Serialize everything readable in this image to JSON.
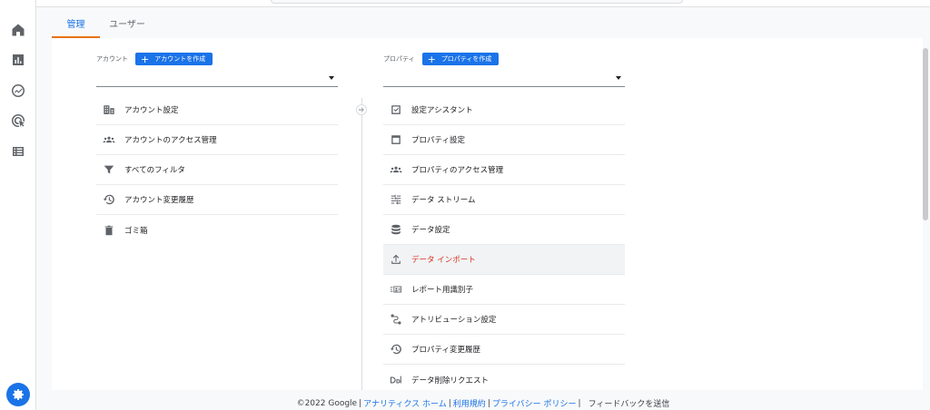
{
  "tabs": [
    {
      "label": "管理",
      "active": true
    },
    {
      "label": "ユーザー",
      "active": false
    }
  ],
  "nav_icons": [
    "home-icon",
    "reports-icon",
    "explore-icon",
    "advertising-icon",
    "list-icon"
  ],
  "account": {
    "title": "アカウント",
    "create_label": "アカウントを作成",
    "items": [
      {
        "label": "アカウント設定",
        "icon": "building-icon"
      },
      {
        "label": "アカウントのアクセス管理",
        "icon": "people-icon"
      },
      {
        "label": "すべてのフィルタ",
        "icon": "filter-icon"
      },
      {
        "label": "アカウント変更履歴",
        "icon": "history-icon"
      },
      {
        "label": "ゴミ箱",
        "icon": "trash-icon"
      }
    ]
  },
  "property": {
    "title": "プロパティ",
    "create_label": "プロパティを作成",
    "items": [
      {
        "label": "設定アシスタント",
        "icon": "checkbox-icon"
      },
      {
        "label": "プロパティ設定",
        "icon": "window-icon"
      },
      {
        "label": "プロパティのアクセス管理",
        "icon": "people-icon"
      },
      {
        "label": "データ ストリーム",
        "icon": "stream-icon"
      },
      {
        "label": "データ設定",
        "icon": "database-icon"
      },
      {
        "label": "データ インポート",
        "icon": "upload-icon",
        "highlight": true
      },
      {
        "label": "レポート用識別子",
        "icon": "identity-icon"
      },
      {
        "label": "アトリビューション設定",
        "icon": "attribution-icon"
      },
      {
        "label": "プロパティ変更履歴",
        "icon": "history-icon"
      },
      {
        "label": "データ削除リクエスト",
        "icon": "dd-icon"
      }
    ]
  },
  "footer": {
    "copyright": "©2022 Google",
    "links": [
      "アナリティクス ホーム",
      "利用規約",
      "プライバシー ポリシー"
    ],
    "feedback": "フィードバックを送信"
  },
  "colors": {
    "accent": "#1a73e8",
    "tab_indicator": "#e8710a",
    "highlight_text": "#d93025"
  }
}
